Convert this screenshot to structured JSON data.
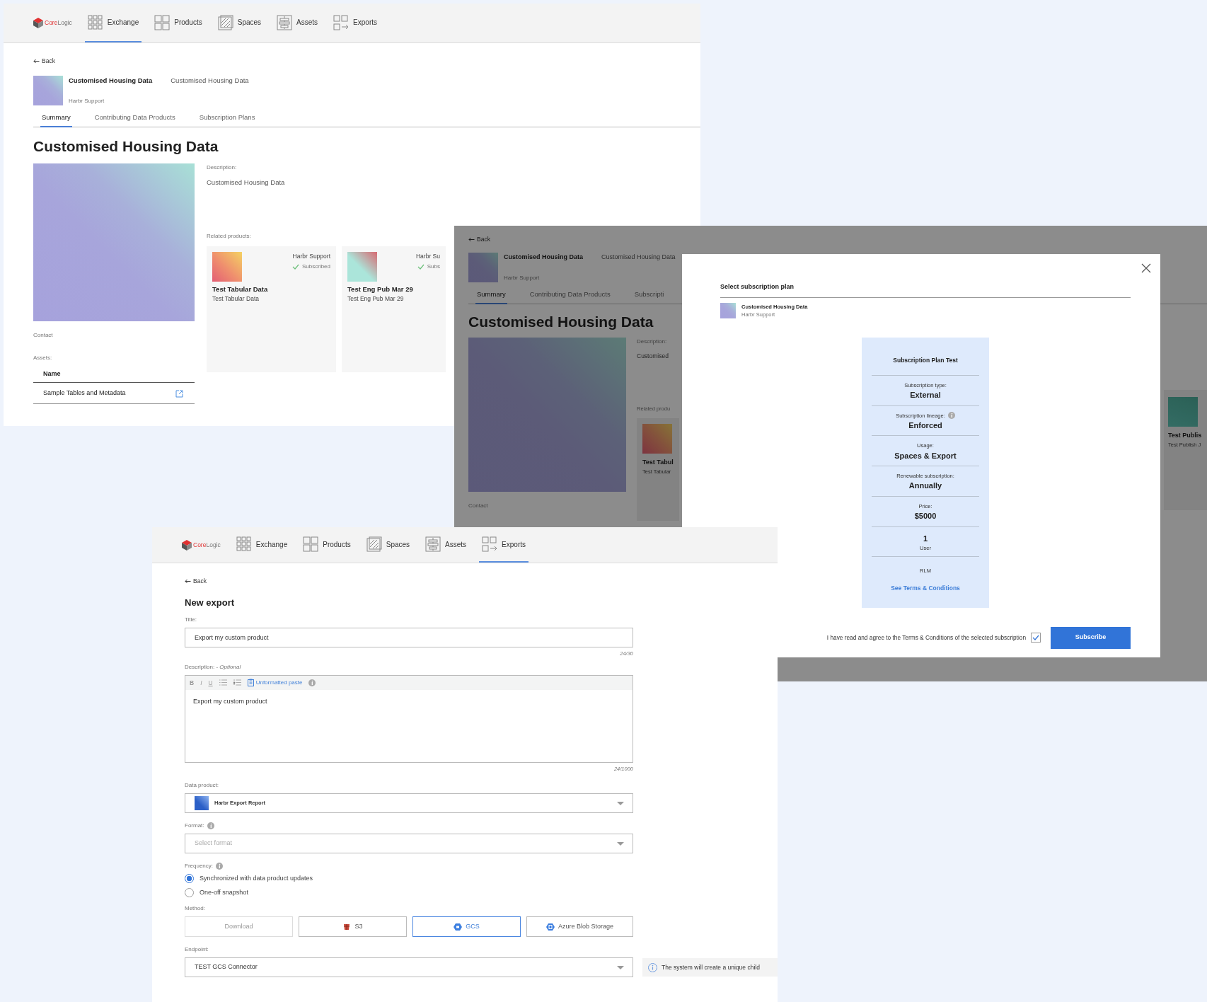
{
  "product_page": {
    "logo": {
      "accent": "Core",
      "rest": "Logic"
    },
    "nav": [
      {
        "label": "Exchange",
        "selected": true
      },
      {
        "label": "Products",
        "selected": false
      },
      {
        "label": "Spaces",
        "selected": false
      },
      {
        "label": "Assets",
        "selected": false
      },
      {
        "label": "Exports",
        "selected": false
      }
    ],
    "back": "Back",
    "header": {
      "title": "Customised Housing Data",
      "subtitle": "Customised Housing Data",
      "owner": "Harbr Support"
    },
    "tabs": [
      {
        "label": "Summary",
        "selected": true
      },
      {
        "label": "Contributing Data Products",
        "selected": false
      },
      {
        "label": "Subscription Plans",
        "selected": false
      }
    ],
    "heading": "Customised Housing Data",
    "description_label": "Description:",
    "description": "Customised Housing Data",
    "related_label": "Related products:",
    "related": [
      {
        "owner": "Harbr Support",
        "status": "Subscribed",
        "subscribed": true,
        "title": "Test Tabular Data",
        "subtitle": "Test Tabular Data"
      },
      {
        "owner": "Harbr Su",
        "status": "Subs",
        "subscribed": true,
        "title": "Test Eng Pub Mar 29",
        "subtitle": "Test Eng Pub Mar 29"
      }
    ],
    "contact_label": "Contact",
    "assets_label": "Assets:",
    "assets_table": {
      "columns": [
        "Name"
      ],
      "rows": [
        [
          "Sample Tables and Metadata"
        ]
      ]
    }
  },
  "dimmed_page": {
    "back": "Back",
    "header": {
      "title": "Customised Housing Data",
      "subtitle": "Customised Housing Data",
      "owner": "Harbr Support"
    },
    "tabs": [
      {
        "label": "Summary",
        "selected": true
      },
      {
        "label": "Contributing Data Products",
        "selected": false
      },
      {
        "label": "Subscripti",
        "selected": false
      }
    ],
    "heading": "Customised Housing Data",
    "description_label": "Description:",
    "description": "Customised",
    "related_label": "Related produ",
    "related": [
      {
        "title": "Test Tabul",
        "subtitle": "Test Tabular"
      }
    ],
    "contact_label": "Contact",
    "side_card": {
      "title": "Test Publis",
      "subtitle": "Test Publish J"
    }
  },
  "subscription_modal": {
    "title": "Select subscription plan",
    "product": {
      "name": "Customised Housing Data",
      "owner": "Harbr Support"
    },
    "plan": {
      "name": "Subscription Plan Test",
      "rows": [
        {
          "kind": "field",
          "label": "Subscription type:",
          "value": "External",
          "info": false
        },
        {
          "kind": "field",
          "label": "Subscription lineage:",
          "value": "Enforced",
          "info": true
        },
        {
          "kind": "field",
          "label": "Usage:",
          "value": "Spaces & Export",
          "info": false
        },
        {
          "kind": "field",
          "label": "Renewable subscription:",
          "value": "Annually",
          "info": false
        },
        {
          "kind": "field",
          "label": "Price:",
          "value": "$5000",
          "info": false
        },
        {
          "kind": "count",
          "label": "User",
          "value": "1"
        }
      ],
      "license": "RLM",
      "terms_link": "See Terms & Conditions"
    },
    "agreement": "I have read and agree to the Terms & Conditions of the selected subscription",
    "agreed": true,
    "subscribe": "Subscribe"
  },
  "export_page": {
    "logo": {
      "accent": "Core",
      "rest": "Logic"
    },
    "nav": [
      {
        "label": "Exchange",
        "selected": false
      },
      {
        "label": "Products",
        "selected": false
      },
      {
        "label": "Spaces",
        "selected": false
      },
      {
        "label": "Assets",
        "selected": false
      },
      {
        "label": "Exports",
        "selected": true
      }
    ],
    "back": "Back",
    "heading": "New export",
    "title_field": {
      "label": "Title:",
      "value": "Export my custom product",
      "counter": "24/30"
    },
    "description_field": {
      "label": "Description: - *Optional*",
      "toolbar": [
        "B",
        "I",
        "U"
      ],
      "paste": "Unformatted paste",
      "value": "Export my custom product",
      "counter": "24/1000"
    },
    "data_product": {
      "label": "Data product:",
      "value": "Harbr Export Report"
    },
    "format": {
      "label": "Format:",
      "placeholder": "Select format"
    },
    "frequency": {
      "label": "Frequency:",
      "options": [
        {
          "label": "Synchronized with data product updates",
          "selected": true
        },
        {
          "label": "One-off snapshot",
          "selected": false
        }
      ]
    },
    "method": {
      "label": "Method:",
      "options": [
        {
          "label": "Download",
          "selected": false,
          "disabled": true
        },
        {
          "label": "S3",
          "selected": false,
          "disabled": false
        },
        {
          "label": "GCS",
          "selected": true,
          "disabled": false
        },
        {
          "label": "Azure Blob Storage",
          "selected": false,
          "disabled": false
        }
      ]
    },
    "endpoint": {
      "label": "Endpoint:",
      "value": "TEST GCS Connector"
    },
    "note": "The system will create a unique child"
  }
}
